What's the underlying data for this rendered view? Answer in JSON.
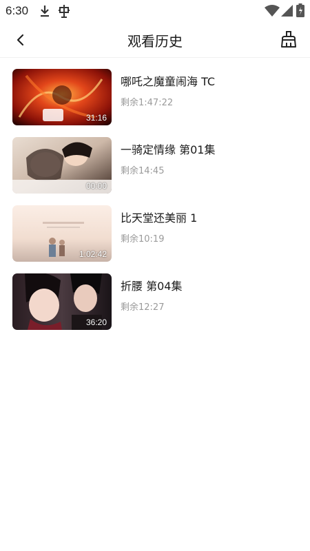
{
  "status_bar": {
    "time": "6:30",
    "icons": [
      "download-icon",
      "bug-icon",
      "wifi-icon",
      "signal-icon",
      "battery-icon"
    ]
  },
  "header": {
    "title": "观看历史",
    "back_icon": "chevron-left-icon",
    "clear_icon": "broom-icon"
  },
  "history": [
    {
      "title": "哪吒之魔童闹海 TC",
      "remaining": "剩余1:47:22",
      "duration": "31:16"
    },
    {
      "title": "一骑定情缘 第01集",
      "remaining": "剩余14:45",
      "duration": "00:00"
    },
    {
      "title": "比天堂还美丽 1",
      "remaining": "剩余10:19",
      "duration": "1:02:42"
    },
    {
      "title": "折腰 第04集",
      "remaining": "剩余12:27",
      "duration": "36:20"
    }
  ]
}
